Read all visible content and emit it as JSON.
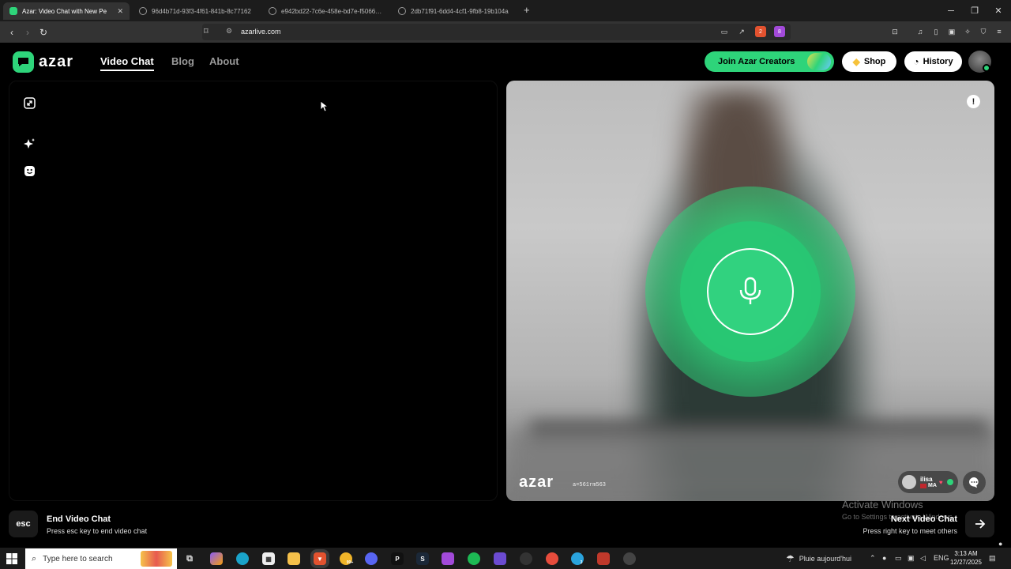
{
  "browser": {
    "tabs": [
      {
        "title": "Azar: Video Chat with New Pe",
        "active": true
      },
      {
        "title": "96d4b71d-93f3-4f61-841b-8c77162",
        "active": false
      },
      {
        "title": "e942bd22-7c6e-458e-bd7e-f5066d1",
        "active": false
      },
      {
        "title": "2db71f91-6dd4-4cf1-9fb8-19b104a",
        "active": false
      }
    ],
    "new_tab_label": "+",
    "url": "azarlive.com",
    "brave_badge": "2",
    "alert_badge": "8"
  },
  "site": {
    "logo_text": "azar",
    "nav": [
      {
        "label": "Video Chat",
        "active": true
      },
      {
        "label": "Blog",
        "active": false
      },
      {
        "label": "About",
        "active": false
      }
    ],
    "join_creators_label": "Join Azar Creators",
    "shop_label": "Shop",
    "history_label": "History"
  },
  "video": {
    "watermark_logo": "azar",
    "watermark_id": "a=561rm563",
    "peer_name": "ilisa",
    "peer_country": "MA"
  },
  "controls": {
    "esc_key": "esc",
    "end_title": "End Video Chat",
    "end_sub": "Press esc key to end video chat",
    "next_title": "Next Video Chat",
    "next_sub": "Press right key to meet others"
  },
  "activation": {
    "title": "Activate Windows",
    "sub": "Go to Settings to activate Windows."
  },
  "taskbar": {
    "search_placeholder": "Type here to search",
    "weather": "Pluie aujourd'hui",
    "language": "ENG",
    "time": "3:13 AM",
    "date": "12/27/2025",
    "badge_1": "99+",
    "badge_2": "3"
  },
  "colors": {
    "brand_green": "#2ed47a",
    "background": "#000000"
  }
}
